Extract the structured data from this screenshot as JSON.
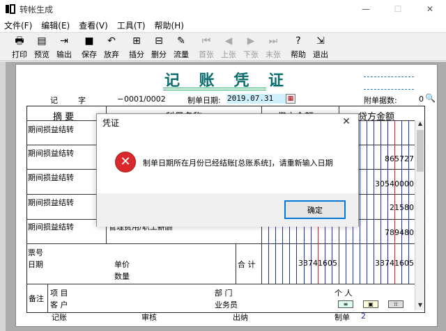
{
  "window": {
    "title": "转帐生成",
    "minimize": "—",
    "maximize": "☐",
    "close": "✕"
  },
  "menu": [
    "文件(F)",
    "编辑(E)",
    "查看(V)",
    "工具(T)",
    "帮助(H)"
  ],
  "toolbar": [
    {
      "label": "打印",
      "icon": "printer-icon",
      "glyph": "🖶",
      "enabled": true
    },
    {
      "label": "预览",
      "icon": "preview-icon",
      "glyph": "▤",
      "enabled": true
    },
    {
      "label": "输出",
      "icon": "export-icon",
      "glyph": "⇥",
      "enabled": true
    },
    {
      "label": "保存",
      "icon": "save-icon",
      "glyph": "■",
      "enabled": true
    },
    {
      "label": "放弃",
      "icon": "undo-icon",
      "glyph": "↶",
      "enabled": true
    },
    {
      "label": "插分",
      "icon": "insert-row-icon",
      "glyph": "⊞",
      "enabled": true
    },
    {
      "label": "删分",
      "icon": "delete-row-icon",
      "glyph": "⊟",
      "enabled": true
    },
    {
      "label": "流量",
      "icon": "cashflow-icon",
      "glyph": "✎",
      "enabled": true
    },
    {
      "label": "首张",
      "icon": "first-page-icon",
      "glyph": "⏮",
      "enabled": false
    },
    {
      "label": "上张",
      "icon": "prev-page-icon",
      "glyph": "◀",
      "enabled": false
    },
    {
      "label": "下张",
      "icon": "next-page-icon",
      "glyph": "▶",
      "enabled": false
    },
    {
      "label": "末张",
      "icon": "last-page-icon",
      "glyph": "⏭",
      "enabled": false
    },
    {
      "label": "帮助",
      "icon": "help-icon",
      "glyph": "?",
      "enabled": true
    },
    {
      "label": "退出",
      "icon": "exit-icon",
      "glyph": "⇲",
      "enabled": true
    }
  ],
  "voucher": {
    "title": "记 账 凭 证",
    "type_label": "记",
    "type_suffix": "字",
    "number": "0001/0002",
    "date_label": "制单日期:",
    "date_value": "2019.07.31",
    "attachments_label": "附单据数:",
    "attachments_value": "0",
    "columns": [
      "摘 要",
      "科目名称",
      "借方金额",
      "贷方金额"
    ],
    "rows": [
      {
        "summary": "期间损益结转",
        "credit": ""
      },
      {
        "summary": "期间损益结转",
        "credit": "865727"
      },
      {
        "summary": "期间损益结转",
        "credit": "30540000"
      },
      {
        "summary": "期间损益结转",
        "credit": "21580"
      },
      {
        "summary": "期间损益结转",
        "subject": "管理费用/职工薪酬",
        "credit": "789480"
      }
    ],
    "ticket_no_label": "票号",
    "date_row_label": "日期",
    "unit_price_label": "单价",
    "quantity_label": "数量",
    "total_label": "合 计",
    "total_debit": "33741605",
    "total_credit": "33741605",
    "notes_label": "备注",
    "project_label": "项  目",
    "customer_label": "客  户",
    "department_label": "部  门",
    "staff_label": "业务员",
    "person_label": "个  人",
    "bookkeeper_label": "记账",
    "reviewer_label": "审核",
    "cashier_label": "出纳",
    "maker_label": "制单",
    "maker_value": "2"
  },
  "dialog": {
    "title": "凭证",
    "message": "制单日期所在月份已经结账[总账系统]，请重新输入日期",
    "ok_label": "确定",
    "close": "✕"
  },
  "colors": {
    "title_teal": "#0a6d6d",
    "date_bg": "#cfeffd",
    "error_red": "#d9282b",
    "digit_red": "#d02020",
    "digit_blue": "#2233aa"
  }
}
